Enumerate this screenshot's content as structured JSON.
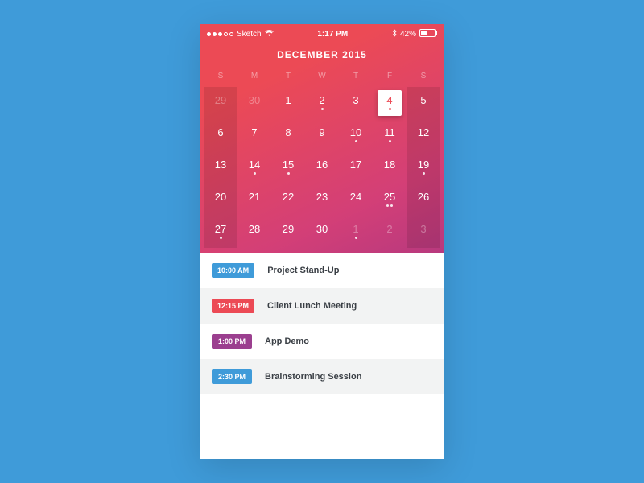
{
  "status_bar": {
    "carrier": "Sketch",
    "time": "1:17 PM",
    "battery": "42%"
  },
  "calendar": {
    "title": "DECEMBER 2015",
    "weekdays": [
      "S",
      "M",
      "T",
      "W",
      "T",
      "F",
      "S"
    ],
    "selected_day": 4,
    "weeks": [
      [
        {
          "d": 29,
          "out": true
        },
        {
          "d": 30,
          "out": true
        },
        {
          "d": 1
        },
        {
          "d": 2,
          "dots": 1
        },
        {
          "d": 3
        },
        {
          "d": 4,
          "dots": 1,
          "selected": true
        },
        {
          "d": 5
        }
      ],
      [
        {
          "d": 6
        },
        {
          "d": 7
        },
        {
          "d": 8
        },
        {
          "d": 9
        },
        {
          "d": 10,
          "dots": 1
        },
        {
          "d": 11,
          "dots": 1
        },
        {
          "d": 12
        }
      ],
      [
        {
          "d": 13
        },
        {
          "d": 14,
          "dots": 1
        },
        {
          "d": 15,
          "dots": 1
        },
        {
          "d": 16
        },
        {
          "d": 17
        },
        {
          "d": 18
        },
        {
          "d": 19,
          "dots": 1
        }
      ],
      [
        {
          "d": 20
        },
        {
          "d": 21
        },
        {
          "d": 22
        },
        {
          "d": 23
        },
        {
          "d": 24
        },
        {
          "d": 25,
          "dots": 2
        },
        {
          "d": 26
        }
      ],
      [
        {
          "d": 27,
          "dots": 1
        },
        {
          "d": 28
        },
        {
          "d": 29
        },
        {
          "d": 30
        },
        {
          "d": 1,
          "out": true,
          "dots": 1
        },
        {
          "d": 2,
          "out": true
        },
        {
          "d": 3,
          "out": true
        }
      ]
    ]
  },
  "events": [
    {
      "time": "10:00 AM",
      "title": "Project Stand-Up",
      "color": "#3f9bd9"
    },
    {
      "time": "12:15 PM",
      "title": "Client Lunch Meeting",
      "color": "#ec4a55"
    },
    {
      "time": "1:00 PM",
      "title": "App Demo",
      "color": "#9b3f8f"
    },
    {
      "time": "2:30 PM",
      "title": "Brainstorming Session",
      "color": "#3f9bd9"
    }
  ]
}
